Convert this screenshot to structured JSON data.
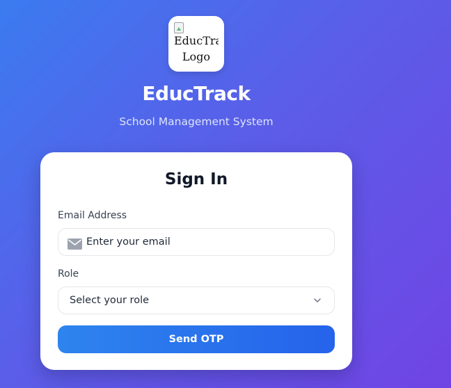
{
  "brand": {
    "logo_alt": "EducTrack Logo",
    "logo_alt_line1": "EducTrack",
    "logo_alt_line2": "Logo",
    "title": "EducTrack",
    "subtitle": "School Management System"
  },
  "signin": {
    "heading": "Sign In",
    "email": {
      "label": "Email Address",
      "placeholder": "Enter your email",
      "value": ""
    },
    "role": {
      "label": "Role",
      "selected": "Select your role"
    },
    "submit_label": "Send OTP"
  },
  "colors": {
    "gradient_start": "#3b7bf0",
    "gradient_end": "#7044e4",
    "button": "#2563eb",
    "card": "#ffffff"
  },
  "icons": {
    "email": "mail-icon",
    "role_dropdown": "chevron-down-icon",
    "logo": "broken-image-icon"
  }
}
